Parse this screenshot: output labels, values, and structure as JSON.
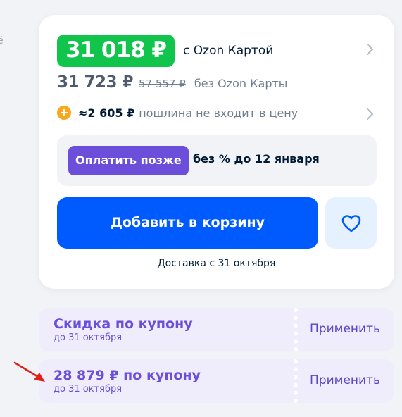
{
  "edge": {
    "text": "ё"
  },
  "price_card": {
    "ozon_price": "31 018 ₽",
    "ozon_label": "с Ozon Картой",
    "regular_price": "31 723 ₽",
    "old_price": "57 557 ₽",
    "regular_label": "без Ozon Карты",
    "duty_value": "≈2 605 ₽",
    "duty_label": "пошлина не входит в цену",
    "pay_later_button": "Оплатить позже",
    "pay_later_text": "без % до 12 января",
    "add_to_cart": "Добавить в корзину",
    "delivery": "Доставка с 31 октября"
  },
  "coupons": [
    {
      "title": "Скидка по купону",
      "subtitle": "до 31 октября",
      "apply": "Применить"
    },
    {
      "title": "28 879 ₽ по купону",
      "subtitle": "до 31 октября",
      "apply": "Применить"
    }
  ],
  "colors": {
    "ozon_green": "#10c44c",
    "brand_blue": "#005bff",
    "pay_later_purple": "#6b4fdb",
    "coupon_bg": "#efedfb",
    "duty_orange": "#f9a71c",
    "annotation_red": "#e0201a"
  },
  "icons": [
    "chevron-right-icon",
    "plus-circle-icon",
    "heart-icon",
    "red-arrow-annotation"
  ]
}
